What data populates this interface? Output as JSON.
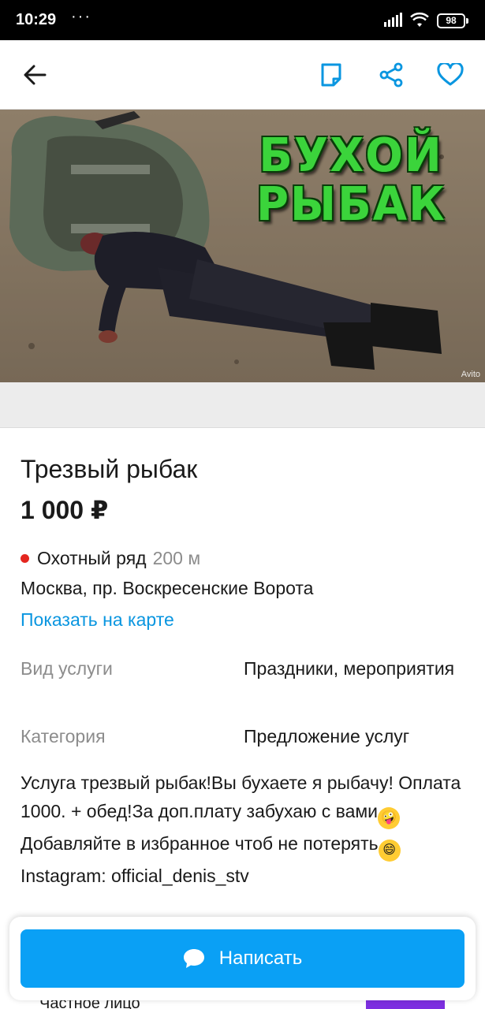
{
  "status_bar": {
    "time": "10:29",
    "dots": "···",
    "battery": "98"
  },
  "toolbar": {
    "back_icon": "arrow-left-icon",
    "note_icon": "note-icon",
    "share_icon": "share-icon",
    "favorite_icon": "heart-icon",
    "accent": "#0a96e0"
  },
  "photo": {
    "caption_line1": "БУХОЙ",
    "caption_line2": "РЫБАК",
    "watermark": "Avito"
  },
  "listing": {
    "title": "Трезвый рыбак",
    "price": "1 000 ₽",
    "metro_station": "Охотный ряд",
    "metro_distance": "200 м",
    "metro_color": "#e4261f",
    "address": "Москва, пр. Воскресенские Ворота",
    "map_link": "Показать на карте",
    "params": [
      {
        "key": "Вид услуги",
        "value": "Праздники, мероприятия"
      },
      {
        "key": "Категория",
        "value": "Предложение услуг"
      }
    ],
    "description": {
      "part1": "Услуга трезвый рыбак!Вы бухаете я рыбачу! Оплата 1000. + обед!За доп.плату забухаю с вами",
      "part2": "Добавляйте в избранное чтоб не потерять",
      "part3": "Instagram: official_denis_stv",
      "emoji1": "🤪",
      "emoji2": "😄"
    }
  },
  "seller": {
    "type_label": "Частное лицо"
  },
  "action": {
    "write_label": "Написать",
    "button_color": "#0aa0f5"
  }
}
